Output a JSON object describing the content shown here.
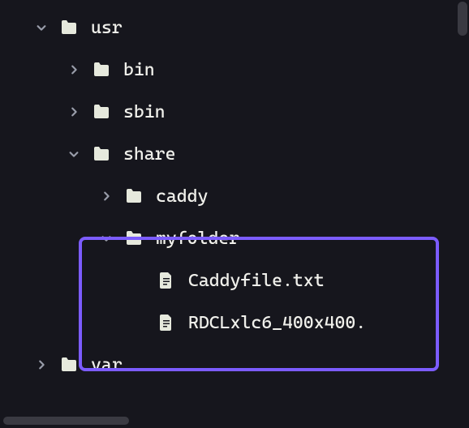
{
  "tree": {
    "usr": {
      "label": "usr"
    },
    "bin": {
      "label": "bin"
    },
    "sbin": {
      "label": "sbin"
    },
    "share": {
      "label": "share"
    },
    "caddy": {
      "label": "caddy"
    },
    "myfolder": {
      "label": "myfolder"
    },
    "caddyfile": {
      "label": "Caddyfile.txt"
    },
    "rdcl": {
      "label": "RDCLxlc6_400x400."
    },
    "var": {
      "label": "var"
    }
  },
  "colors": {
    "highlight": "#7c5cff",
    "background": "#16161d",
    "text": "#f0f0eb"
  }
}
